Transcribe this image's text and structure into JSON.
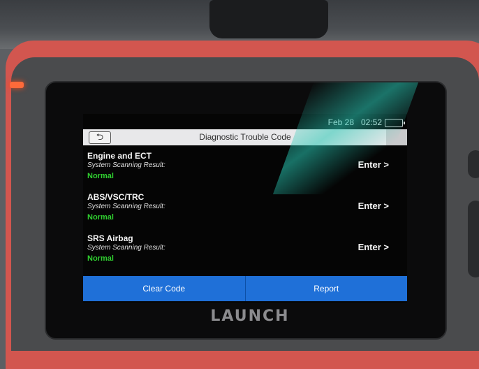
{
  "status_bar": {
    "date": "Feb 28",
    "time": "02:52"
  },
  "title_bar": {
    "back_icon": "back-arrow-icon",
    "title": "Diagnostic Trouble Code"
  },
  "systems": [
    {
      "name": "Engine and ECT",
      "scan_label": "System Scanning Result:",
      "status": "Normal",
      "action": "Enter >"
    },
    {
      "name": "ABS/VSC/TRC",
      "scan_label": "System Scanning Result:",
      "status": "Normal",
      "action": "Enter >"
    },
    {
      "name": "SRS Airbag",
      "scan_label": "System Scanning Result:",
      "status": "Normal",
      "action": "Enter >"
    }
  ],
  "bottom_bar": {
    "clear_label": "Clear Code",
    "report_label": "Report"
  },
  "device": {
    "brand": "LAUNCH"
  },
  "colors": {
    "accent_blue": "#1f70d8",
    "status_green": "#30d030",
    "shell_red": "#d2564f"
  }
}
